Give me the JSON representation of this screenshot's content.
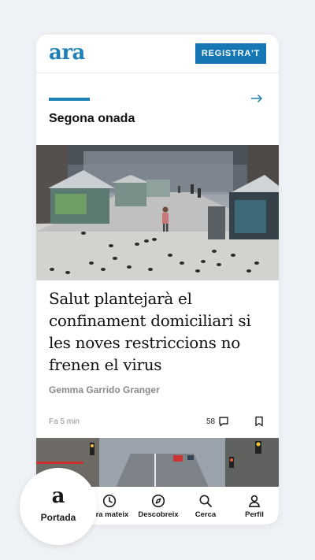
{
  "header": {
    "logo": "ara",
    "register_label": "REGISTRA'T"
  },
  "section": {
    "title": "Segona onada",
    "arrow_icon": "arrow-right-icon"
  },
  "article": {
    "headline": "Salut plantejarà el confinament domiciliari si les noves restriccions no frenen el virus",
    "author": "Gemma Garrido Granger",
    "time": "Fa 5 min",
    "comments_count": "58",
    "image_alt": "La Rambla de Barcelona gairebé buida, amb coloms i quioscos tancats"
  },
  "nav": {
    "active": {
      "icon": "a",
      "label": "Portada"
    },
    "items": [
      {
        "label": "Ara mateix",
        "icon": "clock-icon"
      },
      {
        "label": "Descobreix",
        "icon": "compass-icon"
      },
      {
        "label": "Cerca",
        "icon": "search-icon"
      },
      {
        "label": "Perfil",
        "icon": "user-icon"
      }
    ]
  },
  "colors": {
    "brand": "#1d7fb5",
    "button": "#1578b4",
    "background": "#eef1f5"
  }
}
